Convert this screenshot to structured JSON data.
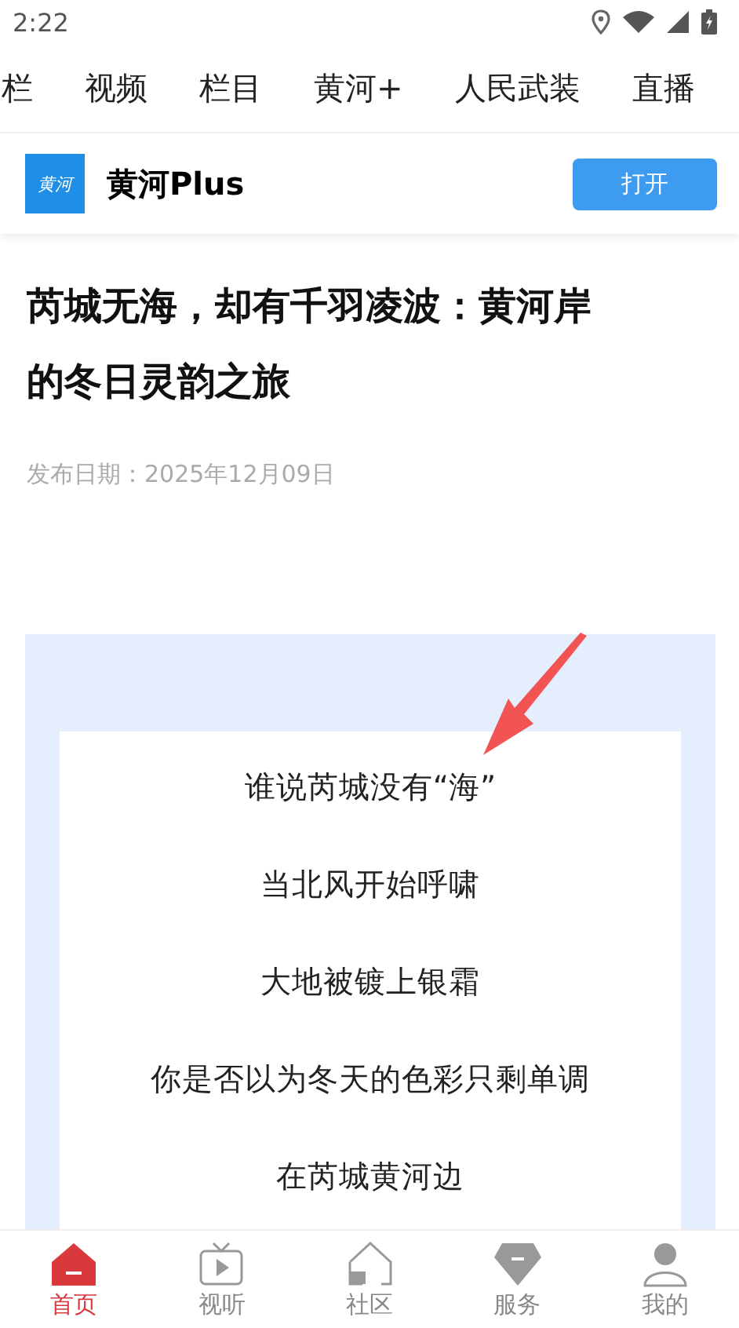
{
  "status_bar": {
    "time": "2:22"
  },
  "channel_tabs": [
    {
      "label": "栏"
    },
    {
      "label": "视频"
    },
    {
      "label": "栏目"
    },
    {
      "label": "黄河+"
    },
    {
      "label": "人民武装"
    },
    {
      "label": "直播"
    }
  ],
  "app_banner": {
    "name": "黄河Plus",
    "logo_text": "黄河",
    "button": "打开"
  },
  "article": {
    "title": "芮城无海，却有千羽凌波：黄河岸的冬日灵韵之旅",
    "date": "发布日期：2025年12月09日",
    "poem_lines": [
      "谁说芮城没有“海”",
      "当北风开始呼啸",
      "大地被镀上银霜",
      "你是否以为冬天的色彩只剩单调",
      "在芮城黄河边"
    ]
  },
  "bottom_nav": [
    {
      "label": "首页",
      "kind": "home",
      "selected": true
    },
    {
      "label": "视听",
      "kind": "tv",
      "selected": false
    },
    {
      "label": "社区",
      "kind": "community",
      "selected": false
    },
    {
      "label": "服务",
      "kind": "service",
      "selected": false
    },
    {
      "label": "我的",
      "kind": "profile",
      "selected": false
    }
  ]
}
